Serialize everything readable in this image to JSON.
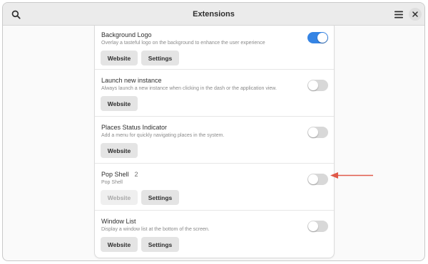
{
  "header": {
    "title": "Extensions",
    "search_icon": "search-icon",
    "menu_icon": "hamburger-menu-icon",
    "close_icon": "close-icon"
  },
  "extensions": [
    {
      "name": "Background Logo",
      "description": "Overlay a tasteful logo on the background to enhance the user experience",
      "enabled": true,
      "buttons": [
        "Website",
        "Settings"
      ]
    },
    {
      "name": "Launch new instance",
      "description": "Always launch a new instance when clicking in the dash or the application view.",
      "enabled": false,
      "buttons": [
        "Website"
      ]
    },
    {
      "name": "Places Status Indicator",
      "description": "Add a menu for quickly navigating places in the system.",
      "enabled": false,
      "buttons": [
        "Website"
      ]
    },
    {
      "name": "Pop Shell",
      "count": "2",
      "description": "Pop Shell",
      "enabled": false,
      "buttons": [
        "Website",
        "Settings"
      ],
      "website_disabled": true
    },
    {
      "name": "Window List",
      "description": "Display a window list at the bottom of the screen.",
      "enabled": false,
      "buttons": [
        "Website",
        "Settings"
      ]
    }
  ],
  "colors": {
    "accent": "#3584e4",
    "annotation_arrow": "#e05a4a"
  }
}
